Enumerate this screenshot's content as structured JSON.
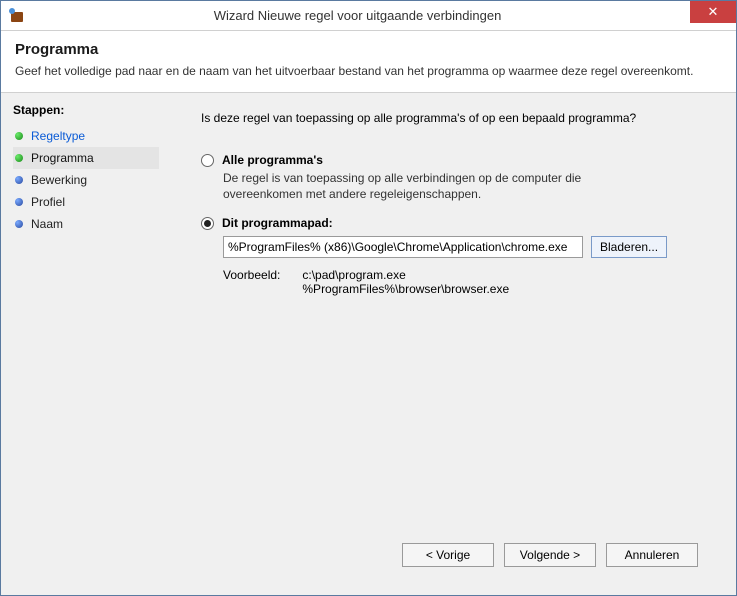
{
  "titlebar": {
    "title": "Wizard Nieuwe regel voor uitgaande verbindingen",
    "close": "✕"
  },
  "header": {
    "title": "Programma",
    "desc": "Geef het volledige pad naar en de naam van het uitvoerbaar bestand van het programma op waarmee deze regel overeenkomt."
  },
  "sidebar": {
    "steps_label": "Stappen:",
    "items": [
      {
        "label": "Regeltype"
      },
      {
        "label": "Programma"
      },
      {
        "label": "Bewerking"
      },
      {
        "label": "Profiel"
      },
      {
        "label": "Naam"
      }
    ]
  },
  "main": {
    "question": "Is deze regel van toepassing op alle programma's of op een bepaald programma?",
    "opt_all": {
      "label": "Alle programma's",
      "desc": "De regel is van toepassing op alle verbindingen op de computer die overeenkomen met andere regeleigenschappen."
    },
    "opt_path": {
      "label": "Dit programmapad:",
      "value": "%ProgramFiles% (x86)\\Google\\Chrome\\Application\\chrome.exe",
      "browse": "Bladeren...",
      "example_label": "Voorbeeld:",
      "example_values": "c:\\pad\\program.exe\n%ProgramFiles%\\browser\\browser.exe"
    }
  },
  "footer": {
    "back": "< Vorige",
    "next": "Volgende >",
    "cancel": "Annuleren"
  }
}
